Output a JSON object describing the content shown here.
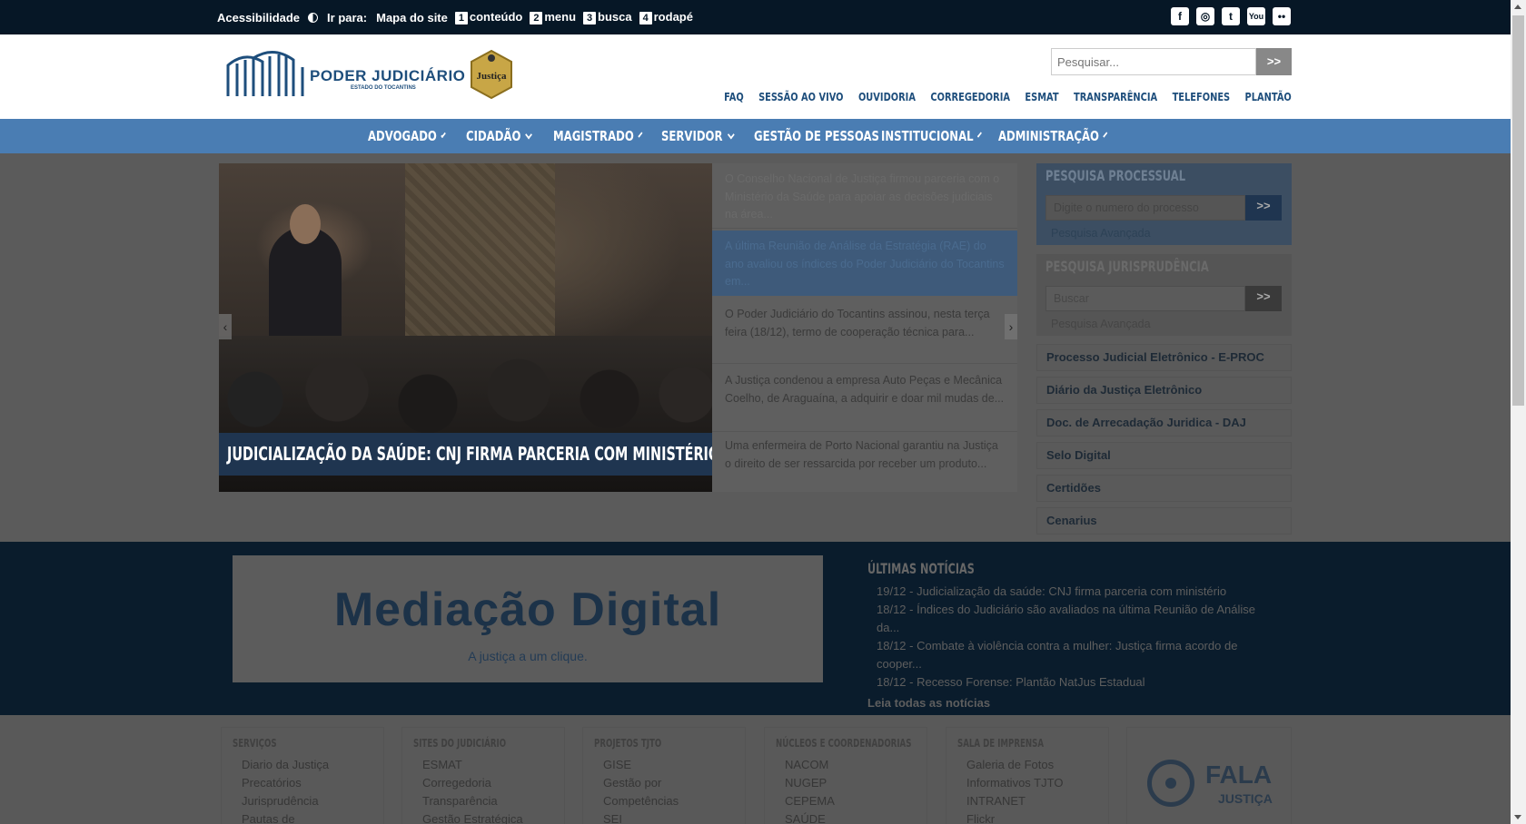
{
  "topbar": {
    "acessibilidade": "Acessibilidade",
    "ir_para": "Ir para:",
    "mapa": "Mapa do site",
    "links": [
      {
        "key": "1",
        "label": "conteúdo"
      },
      {
        "key": "2",
        "label": "menu"
      },
      {
        "key": "3",
        "label": "busca"
      },
      {
        "key": "4",
        "label": "rodapé"
      }
    ],
    "social": [
      "facebook-icon",
      "instagram-icon",
      "twitter-icon",
      "youtube-icon",
      "flickr-icon"
    ]
  },
  "header": {
    "logo_title": "PODER JUDICIÁRIO",
    "logo_subtitle": "ESTADO DO TOCANTINS",
    "seal_text": "Justiça",
    "search_placeholder": "Pesquisar...",
    "search_button": ">>",
    "links": [
      "FAQ",
      "SESSÃO AO VIVO",
      "OUVIDORIA",
      "CORREGEDORIA",
      "ESMAT",
      "TRANSPARÊNCIA",
      "TELEFONES",
      "PLANTÃO"
    ]
  },
  "nav": {
    "items": [
      {
        "label": "ADVOGADO",
        "dropdown": true
      },
      {
        "label": "CIDADÃO",
        "dropdown": true
      },
      {
        "label": "MAGISTRADO",
        "dropdown": true
      },
      {
        "label": "SERVIDOR",
        "dropdown": true
      },
      {
        "label": "GESTÃO DE PESSOAS",
        "dropdown": false
      },
      {
        "label": "INSTITUCIONAL",
        "dropdown": true
      },
      {
        "label": "ADMINISTRAÇÃO",
        "dropdown": true
      }
    ]
  },
  "slider": {
    "caption": "JUDICIALIZAÇÃO DA SAÚDE: CNJ FIRMA PARCERIA COM MINISTÉRIO",
    "prev": "‹",
    "next": "›",
    "news": [
      {
        "text": "O Conselho Nacional de Justiça firmou parceria com o Ministério da Saúde para apoiar as decisões judiciais na área..."
      },
      {
        "text": "A última Reunião de Análise da Estratégia (RAE) do ano avaliou os índices do Poder Judiciário do Tocantins em..."
      },
      {
        "text": "O Poder Judiciário do Tocantins assinou, nesta terça feira (18/12), termo de cooperação técnica para..."
      },
      {
        "text": "A Justiça condenou a empresa Auto Peças e Mecânica Coelho, de Araguaína, a adquirir e doar mil mudas de..."
      },
      {
        "text": "Uma enfermeira de Porto Nacional garantiu na Justiça o direito de ser ressarcida por receber um produto..."
      }
    ]
  },
  "sidebar": {
    "processual": {
      "title": "PESQUISA PROCESSUAL",
      "placeholder": "Digite o numero do processo",
      "button": ">>",
      "advanced": "Pesquisa Avançada"
    },
    "jurisprudencia": {
      "title": "PESQUISA JURISPRUDÊNCIA",
      "placeholder": "Buscar",
      "button": ">>",
      "advanced": "Pesquisa Avançada"
    },
    "links": [
      "Processo Judicial Eletrônico - E-PROC",
      "Diário da Justiça Eletrônico",
      "Doc. de Arrecadação Juridica - DAJ",
      "Selo Digital",
      "Certidões",
      "Cenarius"
    ]
  },
  "banner": {
    "title": "Mediação Digital",
    "subtitle": "A justiça a um clique."
  },
  "ultimas": {
    "heading": "ÚLTIMAS NOTÍCIAS",
    "items": [
      "19/12 - Judicialização da saúde: CNJ firma parceria com ministério",
      "18/12 - Índices do Judiciário são avaliados na última Reunião de Análise da...",
      "18/12 - Combate à violência contra a mulher: Justiça firma acordo de cooper...",
      "18/12 - Recesso Forense: Plantão NatJus Estadual"
    ],
    "all_link": "Leia todas as notícias"
  },
  "footer": {
    "columns": [
      {
        "heading": "SERVIÇOS",
        "items": [
          "Diario da Justiça",
          "Precatórios",
          "Jurisprudência",
          "Pautas de"
        ]
      },
      {
        "heading": "SITES DO JUDICIÁRIO",
        "items": [
          "ESMAT",
          "Corregedoria",
          "Transparência",
          "Gestão Estratégica"
        ]
      },
      {
        "heading": "PROJETOS TJTO",
        "items": [
          "GISE",
          "Gestão por",
          "Competências",
          "SEI"
        ]
      },
      {
        "heading": "NÚCLEOS E COORDENADORIAS",
        "items": [
          "NACOM",
          "NUGEP",
          "CEPEMA",
          "SAÚDE"
        ]
      },
      {
        "heading": "SALA DE IMPRENSA",
        "items": [
          "Galeria de Fotos",
          "Informativos TJTO",
          "INTRANET",
          "Flickr"
        ]
      }
    ],
    "fala_title": "FALA",
    "fala_subtitle": "JUSTIÇA"
  }
}
